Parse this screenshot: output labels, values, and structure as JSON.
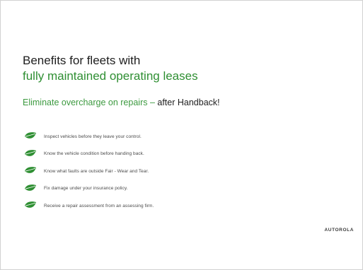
{
  "slide": {
    "title_line1": "Benefits for fleets with",
    "title_line2": "fully maintained operating leases",
    "subtitle_green": "Eliminate overcharge on repairs –",
    "subtitle_dark": " after Handback!",
    "bullets": [
      "Inspect vehicles before they leave your control.",
      "Know the vehicle condition before handing back.",
      "Know what faults are outside Fair - Wear and Tear.",
      "Fix damage under your insurance policy.",
      "Receive a repair assessment from an assessing firm."
    ],
    "logo_text": "AUTOROLA",
    "bullet_icon": "leaf-icon"
  },
  "colors": {
    "accent_green": "#2f8f33",
    "text_dark": "#1e1e1e",
    "bullet_text": "#4a4a4a"
  }
}
